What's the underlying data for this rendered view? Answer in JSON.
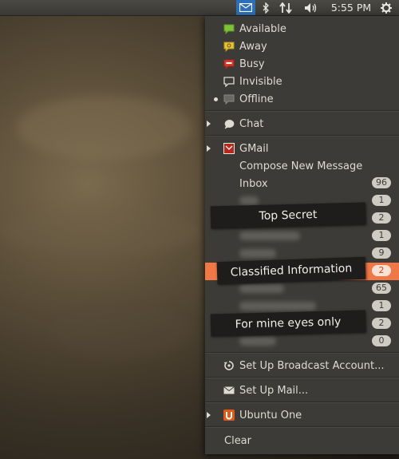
{
  "panel": {
    "clock": "5:55 PM",
    "indicators": [
      "mail-icon",
      "bluetooth-icon",
      "network-icon",
      "volume-icon",
      "gear-icon"
    ],
    "mail_indicator_color": "#2d6fb9"
  },
  "status": {
    "items": [
      {
        "label": "Available",
        "icon": "available-icon",
        "color": "#7ec13b"
      },
      {
        "label": "Away",
        "icon": "away-icon",
        "color": "#e6c43a"
      },
      {
        "label": "Busy",
        "icon": "busy-icon",
        "color": "#d63b2b"
      },
      {
        "label": "Invisible",
        "icon": "invisible-icon"
      },
      {
        "label": "Offline",
        "icon": "offline-icon",
        "selected": true
      }
    ]
  },
  "chat": {
    "label": "Chat"
  },
  "gmail": {
    "label": "GMail",
    "compose": "Compose New Message",
    "inbox": {
      "label": "Inbox",
      "count": "96"
    },
    "folders": [
      {
        "count": "1"
      },
      {
        "count": "2"
      },
      {
        "count": "1"
      },
      {
        "count": "9"
      },
      {
        "count": "2",
        "highlighted": true
      },
      {
        "count": "65"
      },
      {
        "count": "1"
      },
      {
        "count": "2"
      },
      {
        "count": "0"
      }
    ]
  },
  "redactions": [
    "Top Secret",
    "Classified Information",
    "For mine eyes only"
  ],
  "broadcast": {
    "label": "Set Up Broadcast Account..."
  },
  "setup_mail": {
    "label": "Set Up Mail..."
  },
  "ubuntu_one": {
    "label": "Ubuntu One",
    "color": "#e05b1a"
  },
  "clear": {
    "label": "Clear"
  },
  "colors": {
    "menu_bg": "#3c3b37",
    "highlight": "#f07746",
    "text": "#dfdbd2"
  }
}
